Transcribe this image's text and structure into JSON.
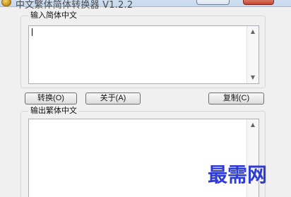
{
  "window": {
    "title": "中文繁体简体转换器 V1.2.2"
  },
  "input_panel": {
    "label": "输入简体中文",
    "text": ""
  },
  "buttons": {
    "convert": "转换(O)",
    "about": "关于(A)",
    "copy": "复制(C)"
  },
  "output_panel": {
    "label": "输出繁体中文",
    "text": ""
  },
  "icons": {
    "scroll_up": "up-arrow",
    "scroll_down": "down-arrow",
    "app": "app-icon"
  },
  "colors": {
    "watermark": "#2f3bd5"
  },
  "watermark": {
    "text": "最需网"
  }
}
